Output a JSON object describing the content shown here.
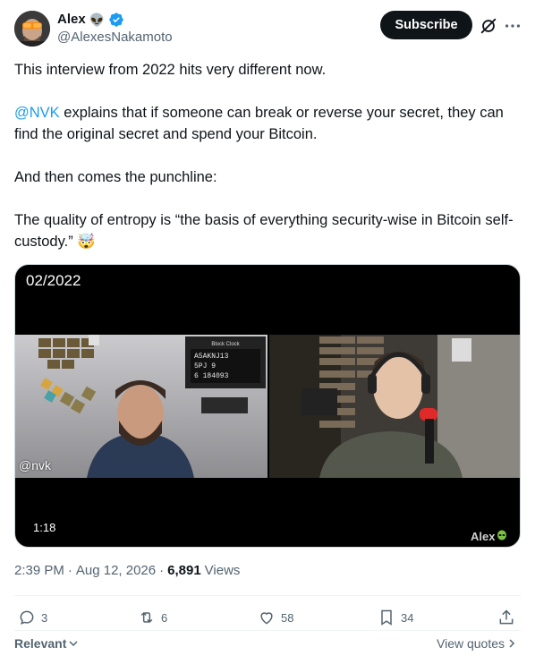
{
  "author": {
    "display_name": "Alex",
    "emoji": "👽",
    "handle": "@AlexesNakamoto",
    "verified": true
  },
  "header": {
    "subscribe_label": "Subscribe",
    "grok_icon": "grok-slash-icon",
    "more_icon": "more-dots-icon"
  },
  "tweet": {
    "p1": "This interview from 2022 hits very different now.",
    "p2_mention": "@NVK",
    "p2_rest": " explains that if someone can break or reverse your secret, they can find the original secret and spend your Bitcoin.",
    "p3": "And then comes the punchline:",
    "p4": "The quality of entropy is “the basis of everything security-wise in Bitcoin self-custody.” 🤯"
  },
  "media": {
    "date_overlay": "02/2022",
    "speaker_tag": "@nvk",
    "duration": "1:18",
    "watermark": "Alex",
    "board_lines": [
      "A5AKNJ13",
      "5PJ   9",
      "6 184093"
    ],
    "board_title": "Block Clock"
  },
  "meta": {
    "time": "2:39 PM",
    "date": "Aug 12, 2026",
    "views_count": "6,891",
    "views_label": "Views"
  },
  "actions": {
    "replies": "3",
    "reposts": "6",
    "likes": "58",
    "bookmarks": "34"
  },
  "footer": {
    "relevant_label": "Relevant",
    "view_quotes_label": "View quotes"
  },
  "colors": {
    "accent": "#1d9bf0",
    "text": "#0f1419",
    "secondary": "#536471",
    "button_bg": "#0f1419"
  }
}
